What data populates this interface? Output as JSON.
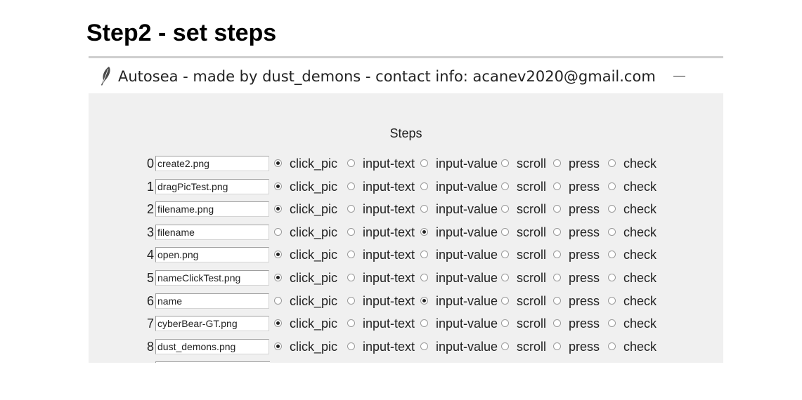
{
  "slide": {
    "title": "Step2 - set steps"
  },
  "window": {
    "title": "Autosea - made by dust_demons - contact info: acanev2020@gmail.com",
    "icon": "feather-icon",
    "minimize_icon": "minimize-icon"
  },
  "steps": {
    "label": "Steps",
    "options": [
      "click_pic",
      "input-text",
      "input-value",
      "scroll",
      "press",
      "check"
    ],
    "rows": [
      {
        "index": "0",
        "value": "create2.png",
        "selected": "click_pic"
      },
      {
        "index": "1",
        "value": "dragPicTest.png",
        "selected": "click_pic"
      },
      {
        "index": "2",
        "value": "filename.png",
        "selected": "click_pic"
      },
      {
        "index": "3",
        "value": "filename",
        "selected": "input-value"
      },
      {
        "index": "4",
        "value": "open.png",
        "selected": "click_pic"
      },
      {
        "index": "5",
        "value": "nameClickTest.png",
        "selected": "click_pic"
      },
      {
        "index": "6",
        "value": "name",
        "selected": "input-value"
      },
      {
        "index": "7",
        "value": "cyberBear-GT.png",
        "selected": "click_pic"
      },
      {
        "index": "8",
        "value": "dust_demons.png",
        "selected": "click_pic"
      }
    ]
  }
}
